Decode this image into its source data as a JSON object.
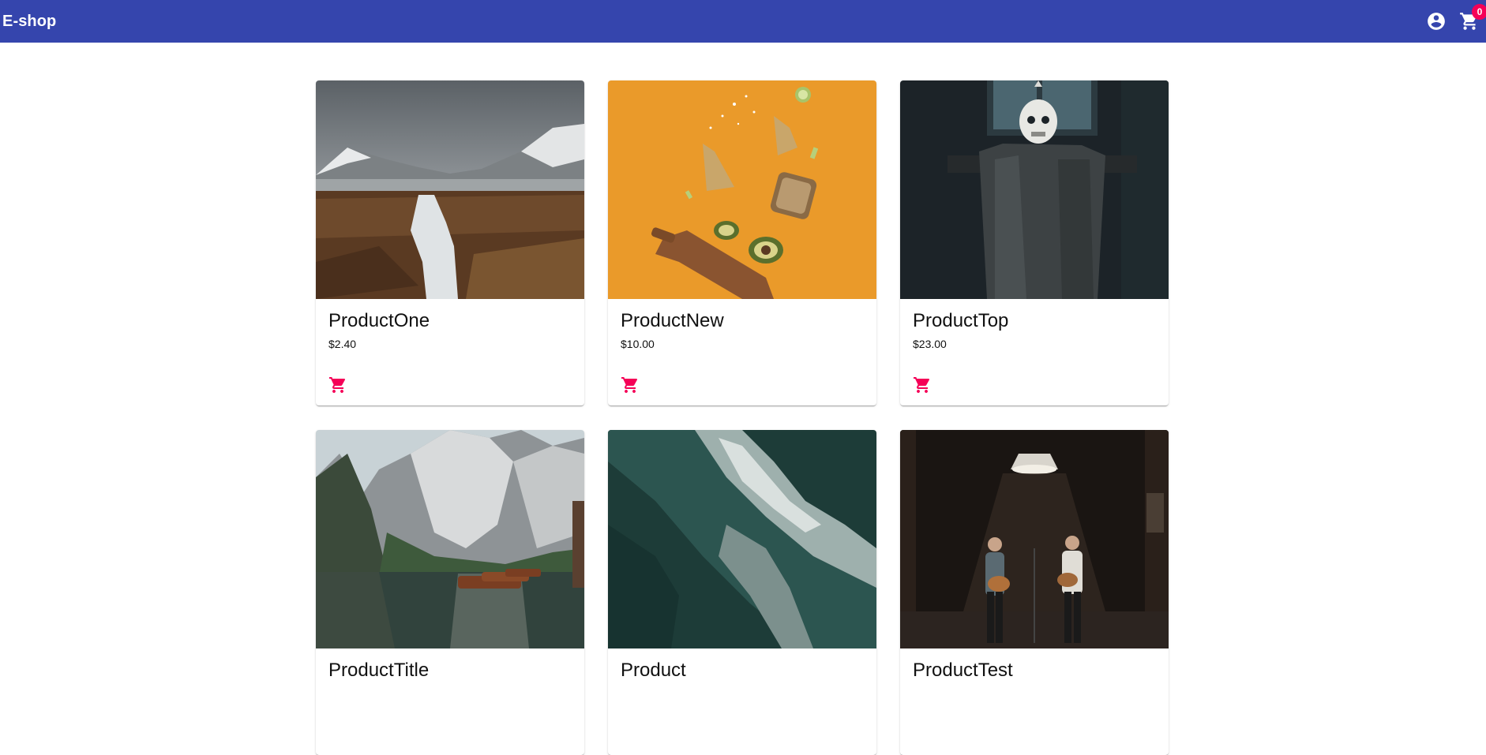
{
  "app": {
    "brand": "E-shop"
  },
  "header": {
    "account_icon": "account-circle-icon",
    "cart_icon": "shopping-cart-icon",
    "cart_count": "0"
  },
  "colors": {
    "appbar": "#3545ad",
    "accent": "#f50057"
  },
  "products": [
    {
      "name": "ProductOne",
      "price": "$2.40",
      "image": "mountain-valley-stream"
    },
    {
      "name": "ProductNew",
      "price": "$10.00",
      "image": "flying-avocado-toast"
    },
    {
      "name": "ProductTop",
      "price": "$23.00",
      "image": "skeleton-decoration"
    },
    {
      "name": "ProductTitle",
      "price": "",
      "image": "mountain-lake-boats"
    },
    {
      "name": "Product",
      "price": "",
      "image": "ocean-waves-aerial"
    },
    {
      "name": "ProductTest",
      "price": "",
      "image": "musicians-on-stage"
    }
  ]
}
